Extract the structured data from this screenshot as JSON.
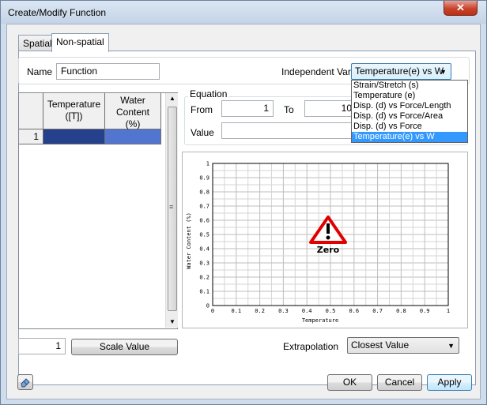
{
  "window": {
    "title": "Create/Modify Function",
    "close_glyph": "✕"
  },
  "tabs": [
    {
      "label": "Spatial"
    },
    {
      "label": "Non-spatial"
    }
  ],
  "name_field": {
    "label": "Name",
    "value": "Function"
  },
  "independent_var": {
    "label": "Independent Var.",
    "selected": "Temperature(e) vs W",
    "options": [
      "Strain/Stretch (s)",
      "Temperature (e)",
      "Disp. (d) vs Force/Length",
      "Disp. (d) vs Force/Area",
      "Disp. (d) vs Force",
      "Temperature(e) vs W"
    ]
  },
  "table": {
    "columns": [
      "Temperature\n([T])",
      "Water\nContent\n(%)"
    ],
    "rows": [
      {
        "index": "1"
      }
    ]
  },
  "equation": {
    "label": "Equation",
    "from_label": "From",
    "from_value": "1",
    "to_label": "To",
    "to_value": "10",
    "value_label": "Value"
  },
  "plot": {
    "warning_text": "Zero",
    "warning_color": "#e00000"
  },
  "chart_data": {
    "type": "line",
    "xlabel": "Temperature",
    "ylabel": "Water Content (%)",
    "xlim": [
      0,
      1
    ],
    "ylim": [
      0,
      1
    ],
    "x_ticks": [
      "0",
      "0.1",
      "0.2",
      "0.3",
      "0.4",
      "0.5",
      "0.6",
      "0.7",
      "0.8",
      "0.9",
      "1"
    ],
    "y_ticks": [
      "0",
      "0.1",
      "0.2",
      "0.3",
      "0.4",
      "0.5",
      "0.6",
      "0.7",
      "0.8",
      "0.9",
      "1"
    ],
    "grid": true,
    "series": []
  },
  "row_count": {
    "value": "1"
  },
  "scale_button": {
    "label": "Scale Value"
  },
  "extrapolation": {
    "label": "Extrapolation",
    "selected": "Closest Value"
  },
  "footer": {
    "ok": "OK",
    "cancel": "Cancel",
    "apply": "Apply",
    "eraser_icon": "eraser-icon"
  }
}
